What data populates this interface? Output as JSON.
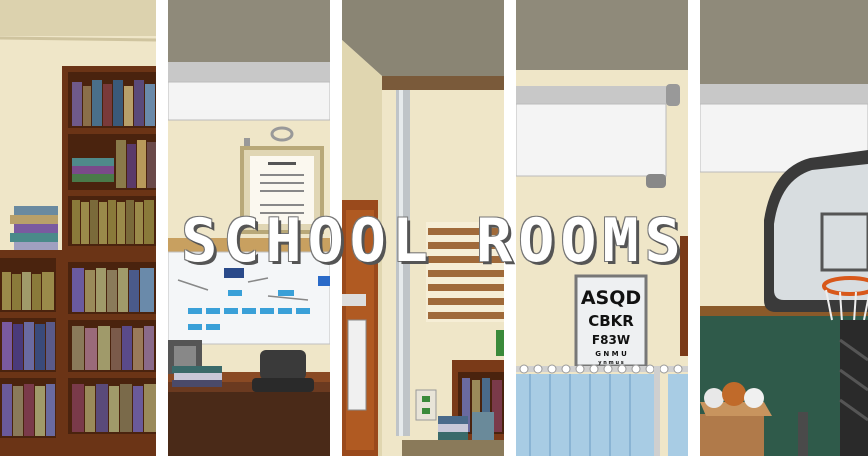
{
  "title": "SCHOOL ROOMS",
  "panels": [
    {
      "name": "library"
    },
    {
      "name": "classroom"
    },
    {
      "name": "hallway-office"
    },
    {
      "name": "infirmary"
    },
    {
      "name": "gym"
    }
  ],
  "eye_chart": {
    "row1": "ASQD",
    "row2": "CBKR",
    "row3": "F83W",
    "row4": "G N M U",
    "row5": "y n m u s"
  },
  "colors": {
    "wall": "#efe6c8",
    "ceiling": "#8a8574",
    "wood": "#7a3f1a",
    "floor_gym": "#2f5a4a"
  }
}
